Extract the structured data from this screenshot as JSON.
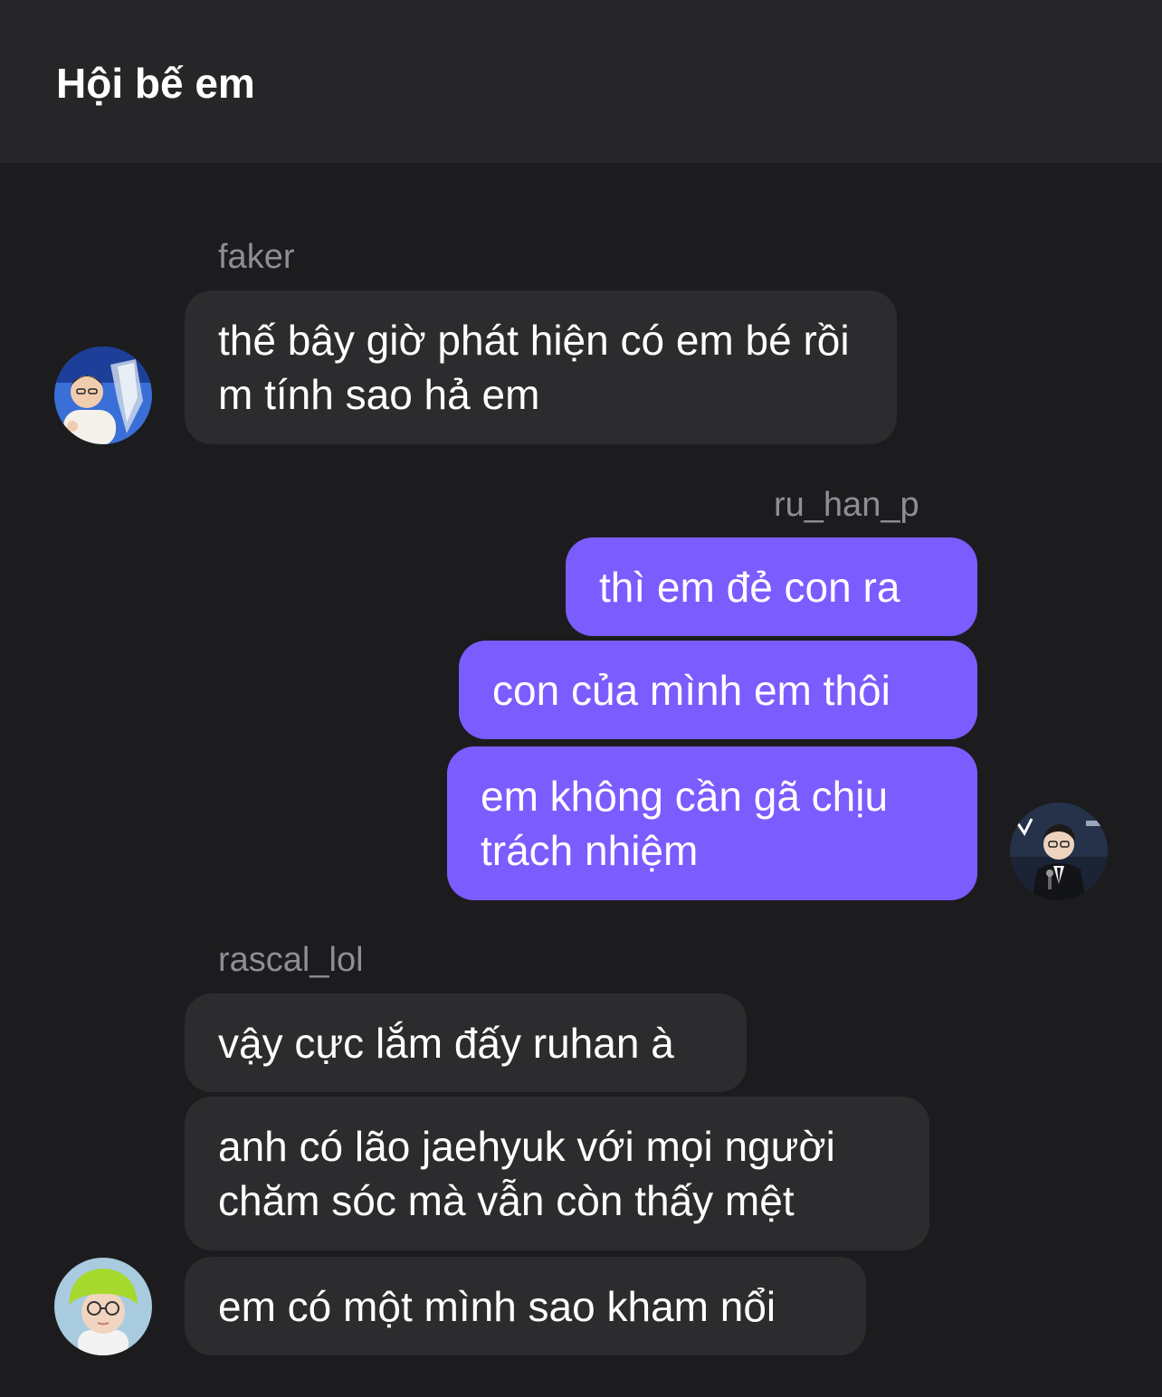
{
  "header": {
    "title": "Hội bế em"
  },
  "messages": {
    "faker": {
      "sender": "faker",
      "m1": "thế bây giờ phát hiện có em bé rồi m tính sao hả em"
    },
    "ruhan": {
      "sender": "ru_han_p",
      "m1": "thì em đẻ con ra",
      "m2": "con của mình em thôi",
      "m3": "em không cần gã chịu trách nhiệm"
    },
    "rascal": {
      "sender": "rascal_lol",
      "m1": "vậy cực lắm đấy ruhan à",
      "m2": "anh có lão jaehyuk với mọi người chăm sóc mà vẫn còn thấy mệt",
      "m3": "em có một mình sao kham nổi"
    }
  },
  "colors": {
    "background": "#1c1c1e",
    "header": "#262628",
    "incoming_bubble": "#2c2c2e",
    "outgoing_bubble": "#7b5cff",
    "sender_text": "#8e8e93"
  }
}
